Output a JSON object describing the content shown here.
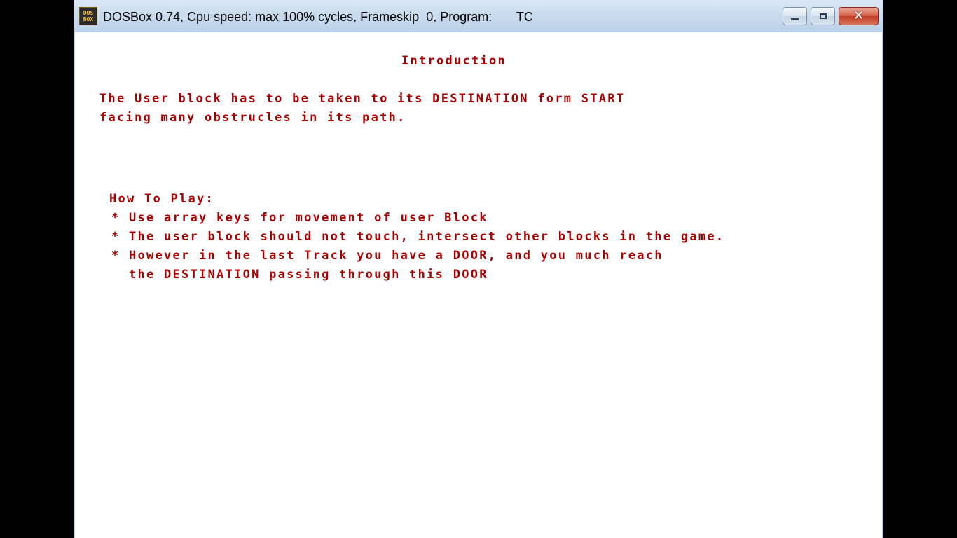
{
  "window": {
    "title": "DOSBox 0.74, Cpu speed: max 100% cycles, Frameskip  0, Program:       TC",
    "icon": "dosbox-icon",
    "icon_label_top": "DOS",
    "icon_label_bottom": "BOX",
    "controls": {
      "minimize_icon": "minimize-icon",
      "maximize_icon": "maximize-icon",
      "close_icon": "close-icon"
    }
  },
  "screen": {
    "heading": "Introduction",
    "intro_lines": [
      "The User block has to be taken to its DESTINATION form START",
      "facing many obstrucles in its path."
    ],
    "how_to_play": {
      "title": "How To Play:",
      "lines": [
        "* Use array keys for movement of user Block",
        "* The user block should not touch, intersect other blocks in the game.",
        "* However in the last Track you have a DOOR, and you much reach",
        "  the DESTINATION passing through this DOOR"
      ]
    },
    "text_color": "#a80000",
    "background_color": "#ffffff"
  }
}
